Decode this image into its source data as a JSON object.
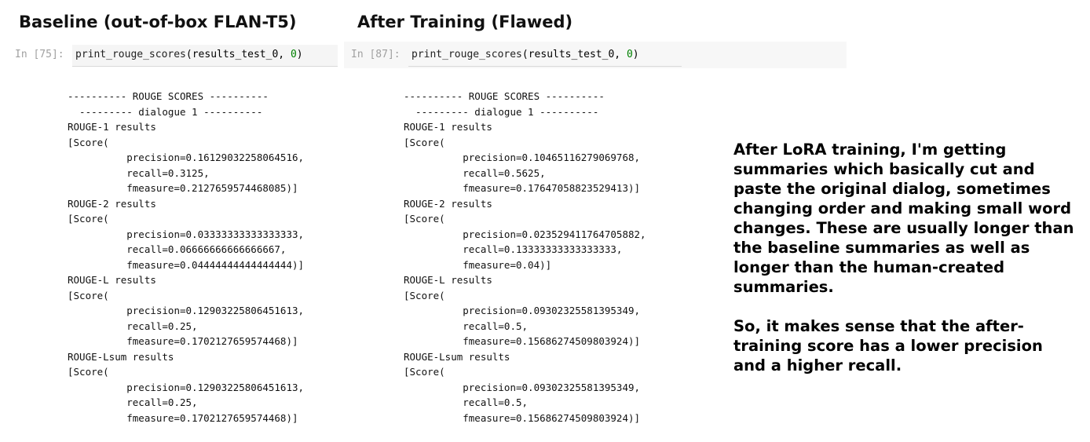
{
  "headings": {
    "left": "Baseline (out-of-box FLAN-T5)",
    "right": "After Training (Flawed)"
  },
  "cells": {
    "left": {
      "prompt": "In [75]:",
      "fn": "print_rouge_scores",
      "args_prefix": "(results_test_0, ",
      "arg_num": "0",
      "args_suffix": ")"
    },
    "right": {
      "prompt": "In [87]:",
      "fn": "print_rouge_scores",
      "args_prefix": "(results_test_0, ",
      "arg_num": "0",
      "args_suffix": ")"
    }
  },
  "outputs": {
    "left": "---------- ROUGE SCORES ----------\n  --------- dialogue 1 ----------\nROUGE-1 results\n[Score(\n          precision=0.16129032258064516,\n          recall=0.3125,\n          fmeasure=0.2127659574468085)]\nROUGE-2 results\n[Score(\n          precision=0.03333333333333333,\n          recall=0.06666666666666667,\n          fmeasure=0.04444444444444444)]\nROUGE-L results\n[Score(\n          precision=0.12903225806451613,\n          recall=0.25,\n          fmeasure=0.1702127659574468)]\nROUGE-Lsum results\n[Score(\n          precision=0.12903225806451613,\n          recall=0.25,\n          fmeasure=0.1702127659574468)]",
    "right": "---------- ROUGE SCORES ----------\n  --------- dialogue 1 ----------\nROUGE-1 results\n[Score(\n          precision=0.10465116279069768,\n          recall=0.5625,\n          fmeasure=0.17647058823529413)]\nROUGE-2 results\n[Score(\n          precision=0.023529411764705882,\n          recall=0.13333333333333333,\n          fmeasure=0.04)]\nROUGE-L results\n[Score(\n          precision=0.09302325581395349,\n          recall=0.5,\n          fmeasure=0.15686274509803924)]\nROUGE-Lsum results\n[Score(\n          precision=0.09302325581395349,\n          recall=0.5,\n          fmeasure=0.15686274509803924)]"
  },
  "note": {
    "paragraph1": "After LoRA training, I'm getting summaries which basically cut and paste the original dialog, sometimes changing order and making small word changes. These are usually longer than the baseline summaries as well as longer than the human-created summaries.",
    "paragraph2": "So, it makes sense that the after-training score has a lower precision and a higher recall."
  }
}
